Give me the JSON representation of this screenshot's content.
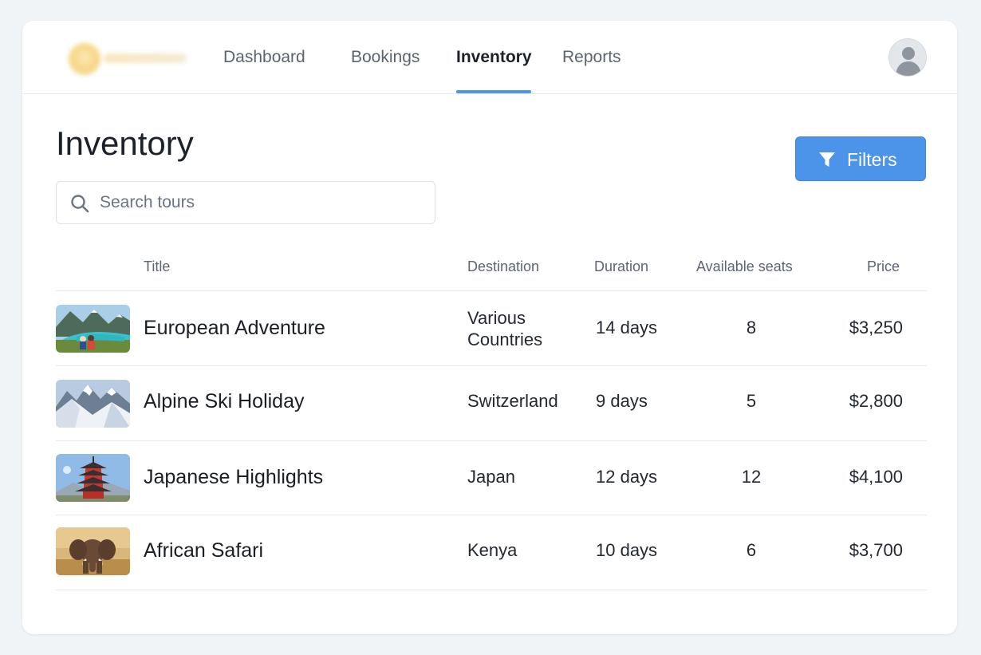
{
  "nav": {
    "links": [
      {
        "label": "Dashboard"
      },
      {
        "label": "Bookings"
      },
      {
        "label": "Inventory"
      },
      {
        "label": "Reports"
      }
    ],
    "active": "Inventory"
  },
  "page": {
    "title": "Inventory"
  },
  "search": {
    "placeholder": "Search tours",
    "value": ""
  },
  "filters": {
    "label": "Filters"
  },
  "table": {
    "headers": {
      "title": "Title",
      "destination": "Destination",
      "duration": "Duration",
      "seats": "Available seats",
      "price": "Price"
    },
    "rows": [
      {
        "title": "European Adventure",
        "destination": "Various Countries",
        "duration": "14 days",
        "seats": "8",
        "price": "$3,250",
        "thumb_icon": "lake-mountains-image"
      },
      {
        "title": "Alpine Ski Holiday",
        "destination": "Switzerland",
        "duration": "9 days",
        "seats": "5",
        "price": "$2,800",
        "thumb_icon": "snowy-mountains-image"
      },
      {
        "title": "Japanese Highlights",
        "destination": "Japan",
        "duration": "12 days",
        "seats": "12",
        "price": "$4,100",
        "thumb_icon": "pagoda-image"
      },
      {
        "title": "African Safari",
        "destination": "Kenya",
        "duration": "10 days",
        "seats": "6",
        "price": "$3,700",
        "thumb_icon": "elephant-image"
      }
    ]
  },
  "colors": {
    "accent": "#4c94ea",
    "background": "#f1f4f6",
    "card": "#ffffff"
  }
}
